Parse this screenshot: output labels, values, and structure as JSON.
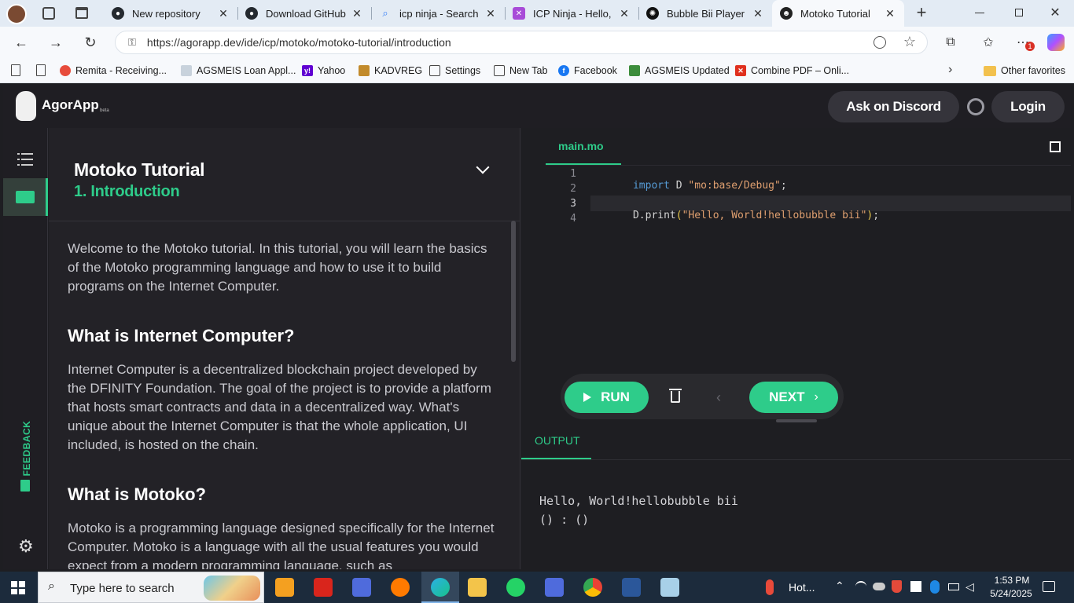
{
  "browser": {
    "tabs": [
      {
        "label": "New repository",
        "icon": "github-icon",
        "color": "#24292f"
      },
      {
        "label": "Download GitHub De",
        "icon": "github-icon",
        "color": "#24292f"
      },
      {
        "label": "icp ninja - Search",
        "icon": "search-icon",
        "color": "#3b82f6"
      },
      {
        "label": "ICP Ninja - Hello, wo",
        "icon": "ninja-icon",
        "color": "#a84bd8"
      },
      {
        "label": "Bubble Bii Player UI",
        "icon": "openai-icon",
        "color": "#111111"
      },
      {
        "label": "Motoko Tutorial",
        "icon": "agorapp-icon",
        "color": "#222222",
        "active": true
      }
    ],
    "url": "https://agorapp.dev/ide/icp/motoko/motoko-tutorial/introduction",
    "notification_badge": "1",
    "favorites": [
      {
        "label": "Remita - Receiving...",
        "icon": "remita-icon",
        "color": "#e74c3c"
      },
      {
        "label": "AGSMEIS Loan Appl...",
        "icon": "page-icon",
        "color": "#6b7b8c"
      },
      {
        "label": "Yahoo",
        "icon": "yahoo-icon",
        "color": "#6001d2"
      },
      {
        "label": "KADVREG",
        "icon": "kadvreg-icon",
        "color": "#c28b2c"
      },
      {
        "label": "Settings",
        "icon": "page-icon",
        "color": "#6b7b8c"
      },
      {
        "label": "New Tab",
        "icon": "page-icon",
        "color": "#6b7b8c"
      },
      {
        "label": "Facebook",
        "icon": "facebook-icon",
        "color": "#1877f2"
      },
      {
        "label": "AGSMEIS Updated",
        "icon": "agsmeis-icon",
        "color": "#3c8d3c"
      },
      {
        "label": "Combine PDF – Onli...",
        "icon": "pdf-icon",
        "color": "#e0301e"
      }
    ],
    "other_favorites": "Other favorites"
  },
  "app": {
    "brand": "AgorApp",
    "brand_tag": "beta",
    "ask_discord": "Ask on Discord",
    "login": "Login",
    "feedback": "FEEDBACK",
    "tutorial_title": "Motoko Tutorial",
    "lesson_title": "1. Introduction",
    "paragraphs": [
      "Welcome to the Motoko tutorial. In this tutorial, you will learn the basics of the Motoko programming language and how to use it to build programs on the Internet Computer.",
      "Internet Computer is a decentralized blockchain project developed by the DFINITY Foundation. The goal of the project is to provide a platform that hosts smart contracts and data in a decentralized way. What's unique about the Internet Computer is that the whole application, UI included, is hosted on the chain.",
      "Motoko is a programming language designed specifically for the Internet Computer. Motoko is a language with all the usual features you would expect from a modern programming language, such as"
    ],
    "headings": [
      "What is Internet Computer?",
      "What is Motoko?"
    ],
    "file_tab": "main.mo",
    "code_lines": [
      {
        "num": "1",
        "text": "import D \"mo:base/Debug\";"
      },
      {
        "num": "2",
        "text": ""
      },
      {
        "num": "3",
        "text": "D.print(\"Hello, World!hellobubble bii\");"
      },
      {
        "num": "4",
        "text": ""
      }
    ],
    "run": "RUN",
    "next": "NEXT",
    "output_tab": "OUTPUT",
    "output_lines": [
      "Hello, World!hellobubble bii",
      "() : ()"
    ],
    "accent": "#2ecc8a"
  },
  "taskbar": {
    "search_placeholder": "Type here to search",
    "weather": "Hot...",
    "time": "1:53 PM",
    "date": "5/24/2025"
  }
}
